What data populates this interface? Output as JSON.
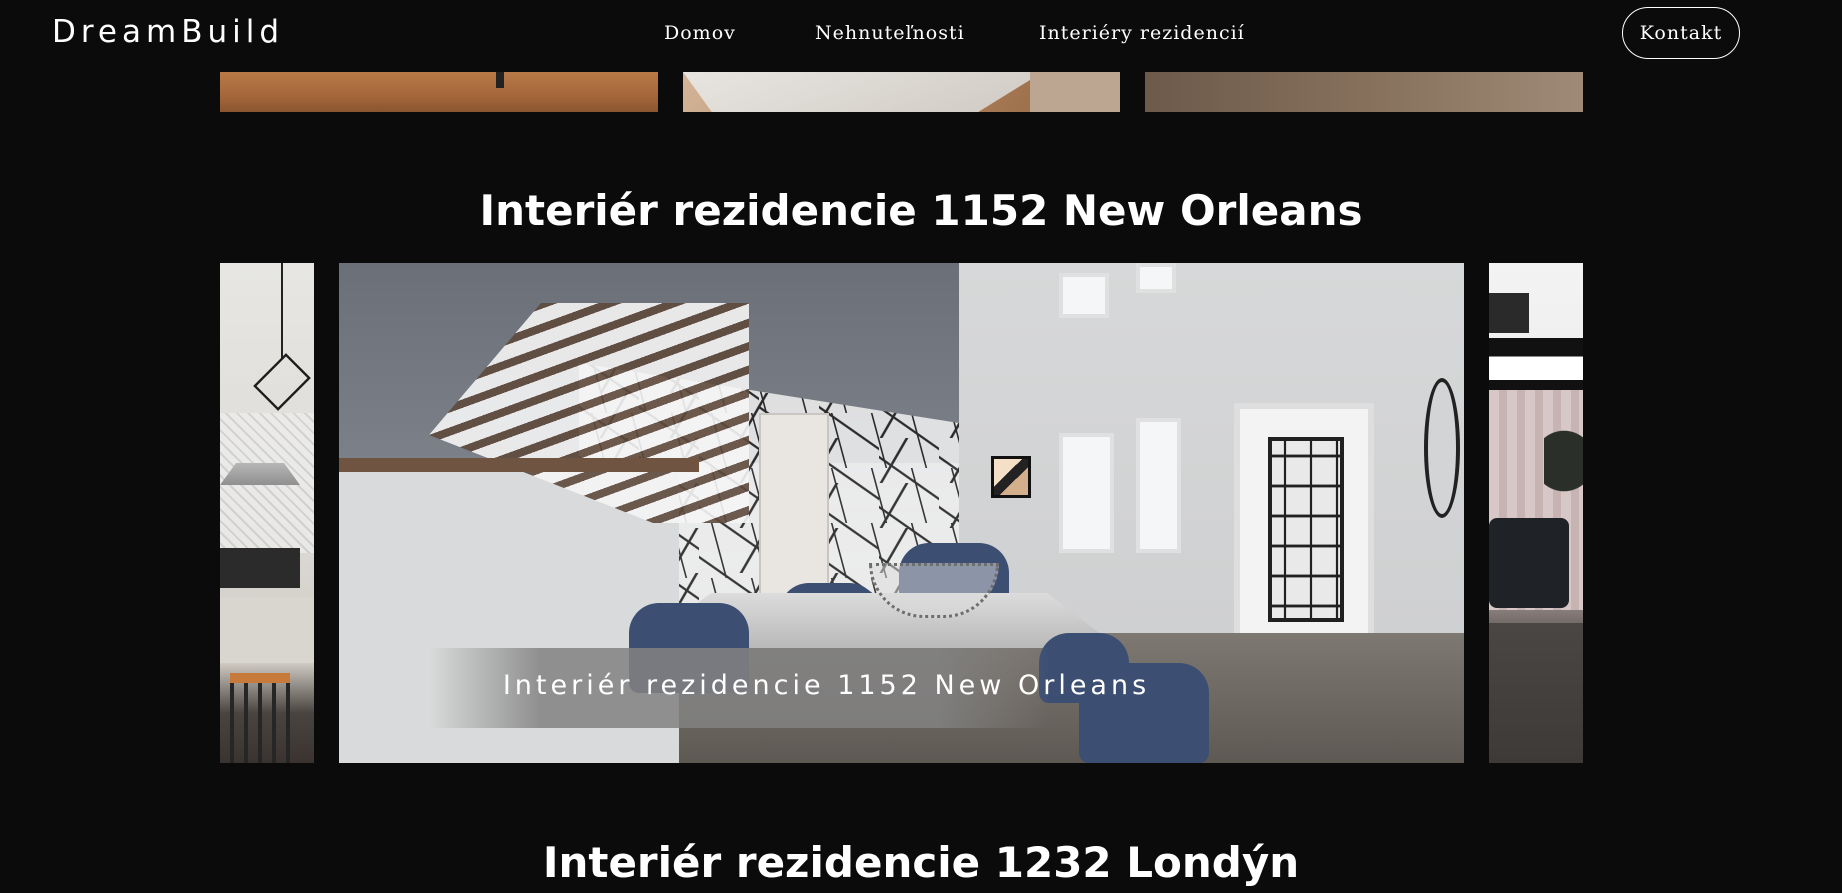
{
  "header": {
    "logo": "DreamBuild",
    "nav": {
      "home": "Domov",
      "properties": "Nehnuteľnosti",
      "interiors": "Interiéry rezidencií"
    },
    "contact_label": "Kontakt"
  },
  "sections": [
    {
      "title": "Interiér rezidencie 1152 New Orleans",
      "slide_caption": "Interiér rezidencie 1152 New Orleans"
    },
    {
      "title": "Interiér rezidencie 1232 Londýn"
    }
  ],
  "colors": {
    "background": "#0b0b0b",
    "text": "#ffffff"
  }
}
